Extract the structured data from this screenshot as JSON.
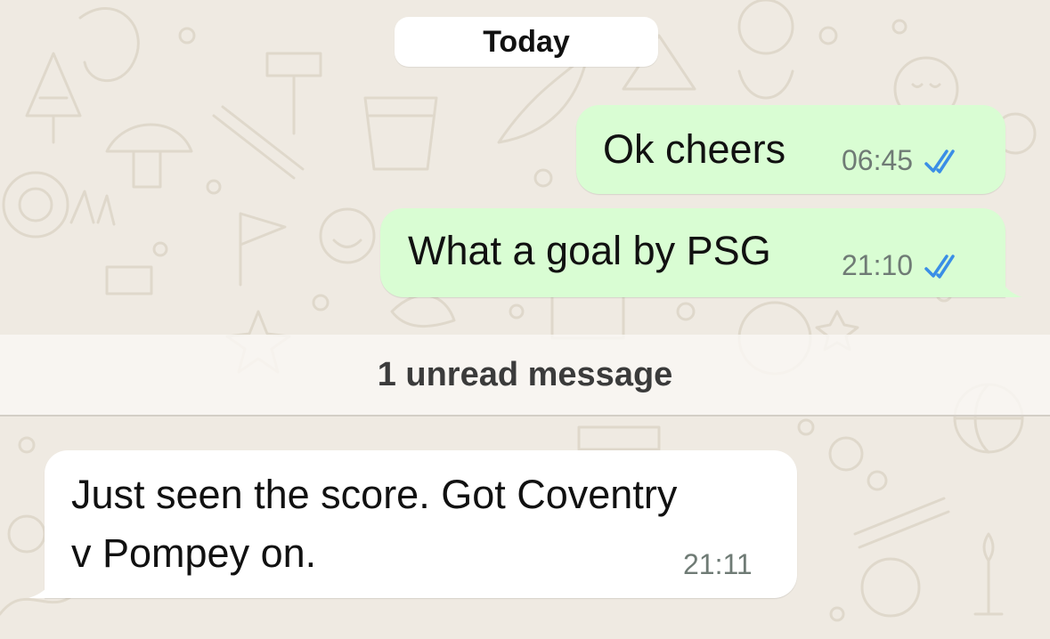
{
  "chat": {
    "date_divider": "Today",
    "unread_divider": "1 unread message",
    "messages": [
      {
        "direction": "outgoing",
        "text": "Ok cheers",
        "time": "06:45",
        "status_icon": "double-check-read-icon"
      },
      {
        "direction": "outgoing",
        "text": "What a goal by PSG",
        "time": "21:10",
        "status_icon": "double-check-read-icon"
      },
      {
        "direction": "incoming",
        "text_lines": [
          "Just seen the score. Got Coventry",
          "v Pompey on."
        ],
        "time": "21:11"
      }
    ]
  },
  "colors": {
    "background": "#efeae2",
    "outgoing_bubble": "#d9fdd3",
    "incoming_bubble": "#ffffff",
    "read_ticks": "#53bdeb",
    "timestamp": "#6f7b75"
  }
}
